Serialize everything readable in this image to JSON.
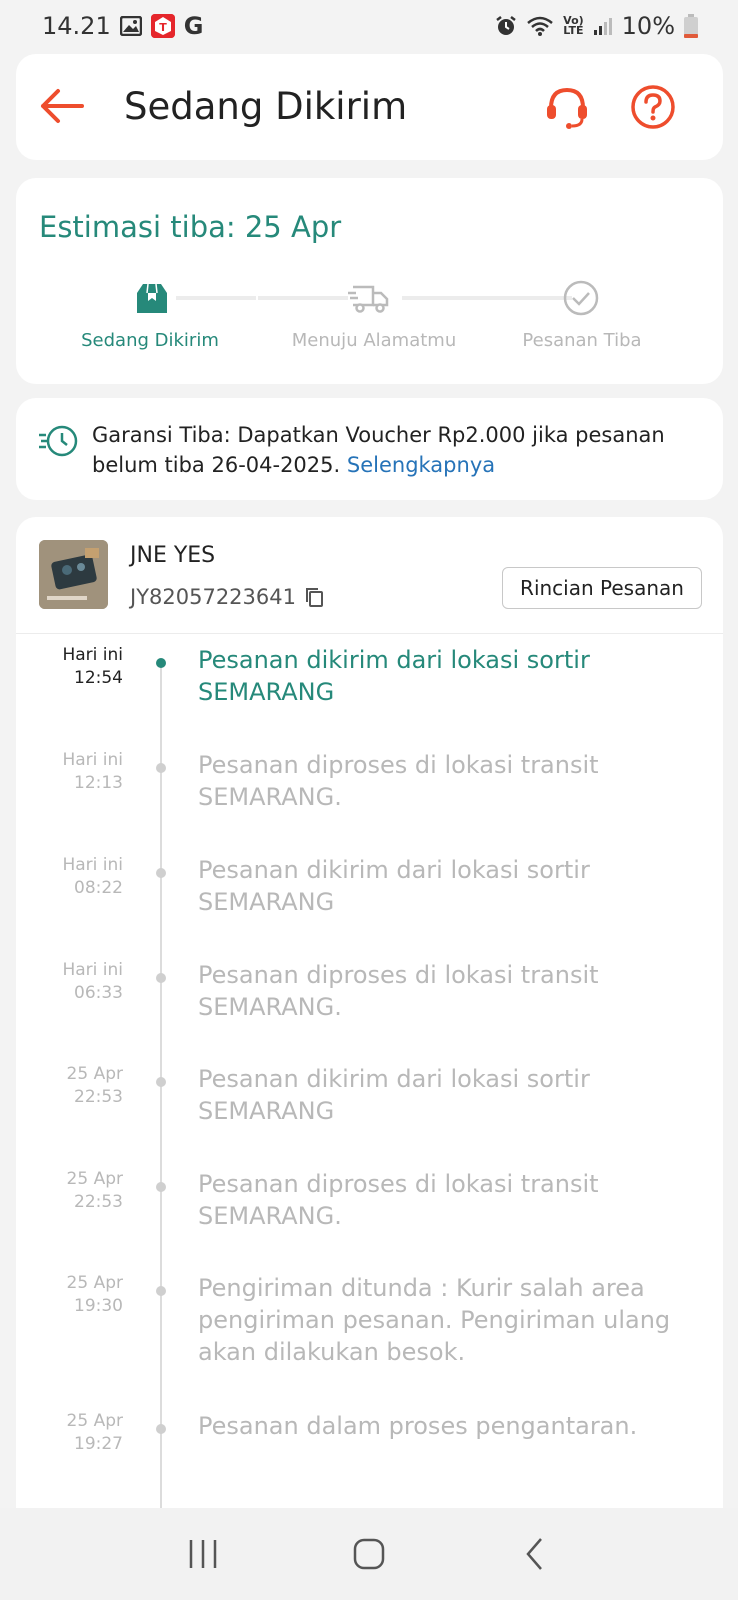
{
  "status_bar": {
    "time": "14.21",
    "app_g": "G",
    "net_top": "Vo)",
    "net_bottom": "LTE",
    "battery": "10%"
  },
  "header": {
    "title": "Sedang Dikirim"
  },
  "estimate": {
    "title": "Estimasi tiba: 25 Apr",
    "steps": [
      {
        "label": "Sedang Dikirim",
        "icon": "box-icon",
        "active": true
      },
      {
        "label": "Menuju Alamatmu",
        "icon": "truck-icon",
        "active": false
      },
      {
        "label": "Pesanan Tiba",
        "icon": "check-circle-icon",
        "active": false
      }
    ]
  },
  "guarantee": {
    "text": "Garansi Tiba: Dapatkan Voucher Rp2.000 jika pesanan belum tiba 26-04-2025.",
    "link": "Selengkapnya"
  },
  "shipment": {
    "courier": "JNE YES",
    "tracking_number": "JY82057223641",
    "detail_button": "Rincian Pesanan"
  },
  "timeline": [
    {
      "day": "Hari ini",
      "time": "12:54",
      "text": "Pesanan dikirim dari lokasi sortir SEMARANG",
      "active": true
    },
    {
      "day": "Hari ini",
      "time": "12:13",
      "text": "Pesanan diproses di lokasi transit SEMARANG.",
      "active": false
    },
    {
      "day": "Hari ini",
      "time": "08:22",
      "text": "Pesanan dikirim dari lokasi sortir SEMARANG",
      "active": false
    },
    {
      "day": "Hari ini",
      "time": "06:33",
      "text": "Pesanan diproses di lokasi transit SEMARANG.",
      "active": false
    },
    {
      "day": "25 Apr",
      "time": "22:53",
      "text": "Pesanan dikirim dari lokasi sortir SEMARANG",
      "active": false
    },
    {
      "day": "25 Apr",
      "time": "22:53",
      "text": "Pesanan diproses di lokasi transit SEMARANG.",
      "active": false
    },
    {
      "day": "25 Apr",
      "time": "19:30",
      "text": "Pengiriman ditunda : Kurir salah area pengiriman pesanan. Pengiriman ulang akan dilakukan besok.",
      "active": false
    },
    {
      "day": "25 Apr",
      "time": "19:27",
      "text": "Pesanan dalam proses pengantaran.",
      "active": false
    }
  ],
  "colors": {
    "accent": "#ee4d2d",
    "teal": "#26897a",
    "link": "#2673b8",
    "muted": "#b8b8b8"
  }
}
